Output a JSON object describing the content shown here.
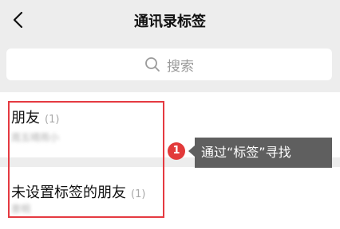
{
  "header": {
    "title": "通讯录标签"
  },
  "search": {
    "placeholder": "搜索"
  },
  "tags": [
    {
      "name": "朋友",
      "count": "(1)",
      "members": "周五晴雨小"
    },
    {
      "name": "未设置标签的朋友",
      "count": "(1)",
      "members": "景明"
    }
  ],
  "callout": {
    "number": "1",
    "text": "通过“标签”寻找"
  },
  "colors": {
    "highlight": "#e53a41",
    "badge": "#e23a3a",
    "tooltip": "#5f5f5f",
    "background": "#ededed"
  }
}
